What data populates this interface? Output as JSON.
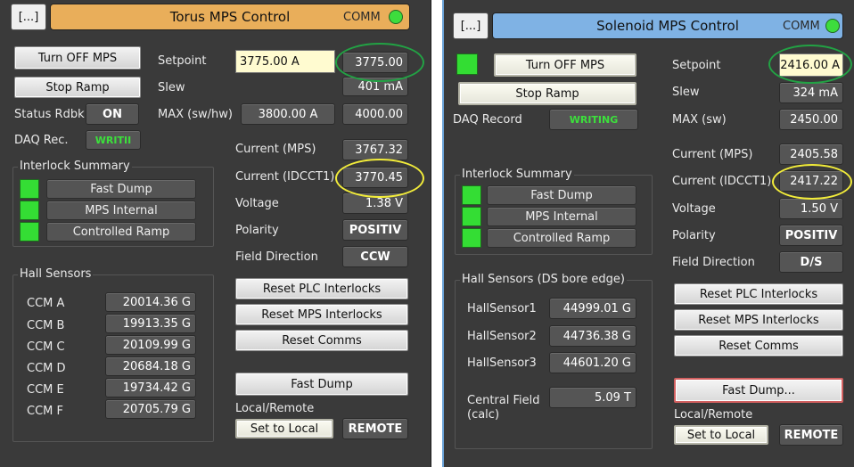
{
  "torus": {
    "menu_label": "[...]",
    "title": "Torus MPS Control",
    "comm_label": "COMM",
    "turn_off_label": "Turn OFF MPS",
    "stop_ramp_label": "Stop Ramp",
    "setpoint_label": "Setpoint",
    "setpoint_input": "3775.00 A",
    "setpoint_readback": "3775.00",
    "slew_label": "Slew",
    "slew_value": "401 mA",
    "status_label": "Status Rdbk",
    "status_value": "ON",
    "max_label": "MAX (sw/hw)",
    "max_sw": "3800.00 A",
    "max_hw": "4000.00",
    "daq_label": "DAQ Rec.",
    "daq_value": "WRITII",
    "current_mps_label": "Current (MPS)",
    "current_mps_value": "3767.32",
    "current_idcct_label": "Current (IDCCT1)",
    "current_idcct_value": "3770.45",
    "voltage_label": "Voltage",
    "voltage_value": "1.38 V",
    "polarity_label": "Polarity",
    "polarity_value": "POSITIV",
    "field_dir_label": "Field Direction",
    "field_dir_value": "CCW",
    "interlock_title": "Interlock Summary",
    "interlocks": [
      "Fast Dump",
      "MPS Internal",
      "Controlled Ramp"
    ],
    "hall_title": "Hall Sensors",
    "hall_sensors": [
      {
        "name": "CCM A",
        "value": "20014.36 G"
      },
      {
        "name": "CCM B",
        "value": "19913.35 G"
      },
      {
        "name": "CCM C",
        "value": "20109.99 G"
      },
      {
        "name": "CCM D",
        "value": "20684.18 G"
      },
      {
        "name": "CCM E",
        "value": "19734.42 G"
      },
      {
        "name": "CCM F",
        "value": "20705.79 G"
      }
    ],
    "reset_plc_label": "Reset PLC Interlocks",
    "reset_mps_label": "Reset MPS Interlocks",
    "reset_comms_label": "Reset Comms",
    "fast_dump_label": "Fast Dump",
    "local_remote_label": "Local/Remote",
    "set_local_label": "Set to Local",
    "remote_value": "REMOTE"
  },
  "solenoid": {
    "menu_label": "[...]",
    "title": "Solenoid MPS Control",
    "comm_label": "COMM",
    "turn_off_label": "Turn OFF MPS",
    "stop_ramp_label": "Stop Ramp",
    "setpoint_label": "Setpoint",
    "setpoint_input": "2416.00 A",
    "slew_label": "Slew",
    "slew_value": "324 mA",
    "daq_label": "DAQ Record",
    "daq_value": "WRITING",
    "max_label": "MAX (sw)",
    "max_value": "2450.00",
    "current_mps_label": "Current (MPS)",
    "current_mps_value": "2405.58",
    "current_idcct_label": "Current (IDCCT1)",
    "current_idcct_value": "2417.22",
    "voltage_label": "Voltage",
    "voltage_value": "1.50 V",
    "polarity_label": "Polarity",
    "polarity_value": "POSITIV",
    "field_dir_label": "Field Direction",
    "field_dir_value": "D/S",
    "interlock_title": "Interlock Summary",
    "interlocks": [
      "Fast Dump",
      "MPS Internal",
      "Controlled Ramp"
    ],
    "hall_title": "Hall Sensors (DS bore edge)",
    "hall_sensors": [
      {
        "name": "HallSensor1",
        "value": "44999.01 G"
      },
      {
        "name": "HallSensor2",
        "value": "44736.38 G"
      },
      {
        "name": "HallSensor3",
        "value": "44601.20 G"
      }
    ],
    "central_field_label": "Central Field\n(calc)",
    "central_field_line1": "Central Field",
    "central_field_line2": "(calc)",
    "central_field_value": "5.09 T",
    "reset_plc_label": "Reset PLC Interlocks",
    "reset_mps_label": "Reset MPS Interlocks",
    "reset_comms_label": "Reset Comms",
    "fast_dump_label": "Fast Dump...",
    "local_remote_label": "Local/Remote",
    "set_local_label": "Set to Local",
    "remote_value": "REMOTE"
  },
  "colors": {
    "panel_bg": "#3a3a3a",
    "torus_title": "#e9ae5a",
    "solenoid_title": "#7fb2e4",
    "comm_led": "#3ddc3d",
    "annotation_green": "#22a244",
    "annotation_yellow": "#f2ec3a"
  }
}
